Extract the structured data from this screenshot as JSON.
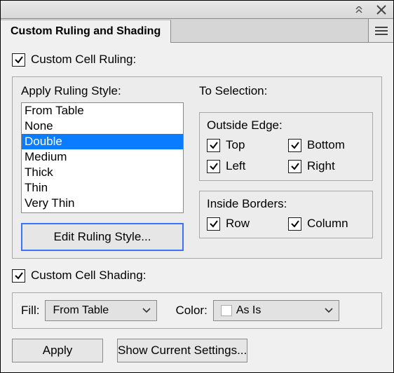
{
  "titlebar": {},
  "tab": {
    "label": "Custom Ruling and Shading"
  },
  "ruling": {
    "checkbox_label": "Custom Cell Ruling:",
    "apply_label": "Apply Ruling Style:",
    "styles": [
      "From Table",
      "None",
      "Double",
      "Medium",
      "Thick",
      "Thin",
      "Very Thin"
    ],
    "selected_index": 2,
    "edit_button": "Edit Ruling Style..."
  },
  "selection": {
    "heading": "To Selection:",
    "outside": {
      "title": "Outside Edge:",
      "top": "Top",
      "bottom": "Bottom",
      "left": "Left",
      "right": "Right"
    },
    "inside": {
      "title": "Inside Borders:",
      "row": "Row",
      "column": "Column"
    }
  },
  "shading": {
    "checkbox_label": "Custom Cell Shading:",
    "fill_label": "Fill:",
    "fill_value": "From Table",
    "color_label": "Color:",
    "color_value": "As Is"
  },
  "buttons": {
    "apply": "Apply",
    "show": "Show Current Settings..."
  }
}
